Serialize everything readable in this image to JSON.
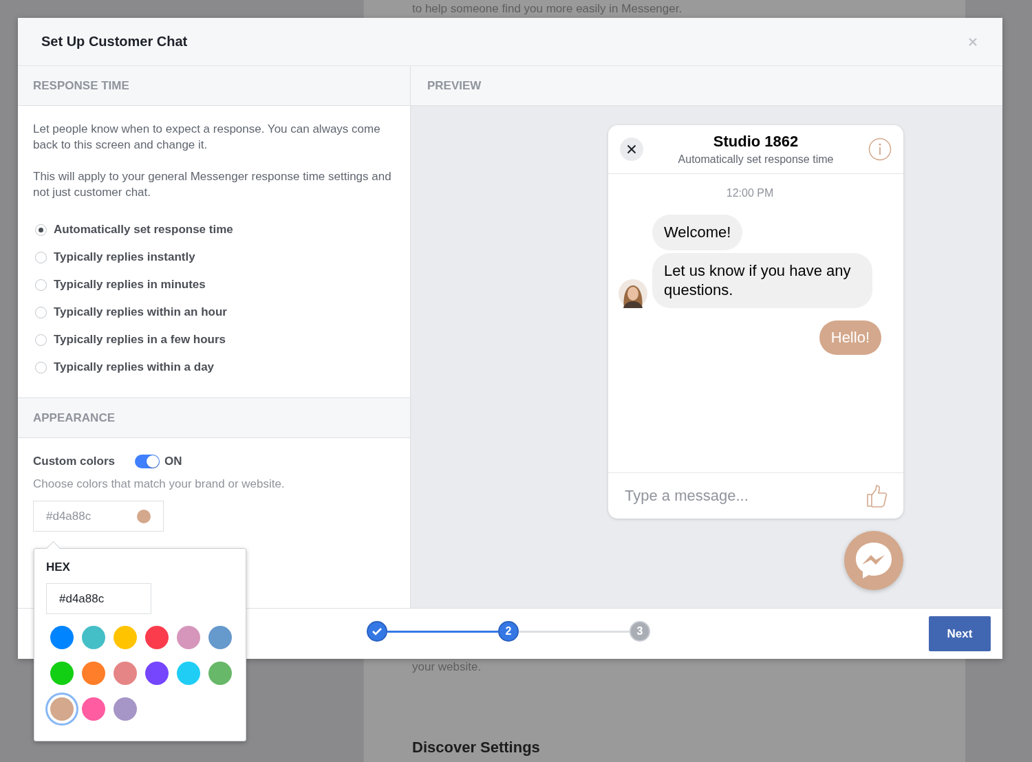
{
  "background_page": {
    "lines": [
      "to help someone find you more easily in Messenger."
    ],
    "lower_line": "your website.",
    "heading": "Discover Settings"
  },
  "dialog": {
    "title": "Set Up Customer Chat",
    "response_time": {
      "heading": "RESPONSE TIME",
      "paragraphs": [
        "Let people know when to expect a response. You can always come back to this screen and change it.",
        "This will apply to your general Messenger response time settings and not just customer chat."
      ],
      "options": [
        {
          "label": "Automatically set response time",
          "selected": true
        },
        {
          "label": "Typically replies instantly",
          "selected": false
        },
        {
          "label": "Typically replies in minutes",
          "selected": false
        },
        {
          "label": "Typically replies within an hour",
          "selected": false
        },
        {
          "label": "Typically replies in a few hours",
          "selected": false
        },
        {
          "label": "Typically replies within a day",
          "selected": false
        }
      ]
    },
    "appearance": {
      "heading": "APPEARANCE",
      "custom_colors": {
        "label": "Custom colors",
        "on": true,
        "state_label": "ON"
      },
      "hint": "Choose colors that match your brand or website.",
      "color_field": {
        "value": "#d4a88c",
        "color": "#d4a88c"
      }
    },
    "color_picker": {
      "heading": "HEX",
      "value": "#d4a88c",
      "swatches": [
        {
          "color": "#0084ff",
          "selected": false
        },
        {
          "color": "#44bec7",
          "selected": false
        },
        {
          "color": "#ffc300",
          "selected": false
        },
        {
          "color": "#fa3c4c",
          "selected": false
        },
        {
          "color": "#d696bb",
          "selected": false
        },
        {
          "color": "#6699cc",
          "selected": false
        },
        {
          "color": "#13cf13",
          "selected": false
        },
        {
          "color": "#ff7e29",
          "selected": false
        },
        {
          "color": "#e68585",
          "selected": false
        },
        {
          "color": "#7646ff",
          "selected": false
        },
        {
          "color": "#20cef5",
          "selected": false
        },
        {
          "color": "#67b868",
          "selected": false
        },
        {
          "color": "#d4a88c",
          "selected": true
        },
        {
          "color": "#ff5ca1",
          "selected": false
        },
        {
          "color": "#a695c7",
          "selected": false
        }
      ]
    },
    "preview": {
      "heading": "PREVIEW",
      "chat": {
        "title": "Studio 1862",
        "subtitle": "Automatically set response time",
        "time": "12:00 PM",
        "messages": [
          {
            "kind": "received",
            "text": "Welcome!"
          },
          {
            "kind": "received",
            "text": "Let us know if you have any questions."
          },
          {
            "kind": "sent",
            "text": "Hello!"
          }
        ],
        "composer": {
          "placeholder": "Type a message..."
        }
      }
    },
    "steps": [
      {
        "kind": "done"
      },
      {
        "kind": "current",
        "label": "2"
      },
      {
        "kind": "upcoming",
        "label": "3"
      }
    ],
    "next_button": "Next"
  }
}
